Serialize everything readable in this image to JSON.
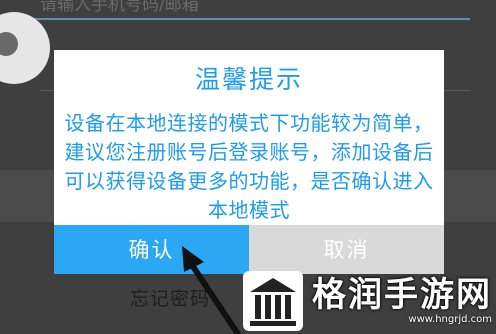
{
  "background": {
    "username_placeholder": "请输入手机号码/邮箱",
    "forgot_password": "忘记密码"
  },
  "dialog": {
    "title": "温馨提示",
    "message": "设备在本地连接的模式下功能较为简单，建议您注册账号后登录账号，添加设备后可以获得设备更多的功能，是否确认进入本地模式",
    "confirm_label": "确认",
    "cancel_label": "取消"
  },
  "watermark": {
    "title": "格润手游网",
    "url": "www.hngrjd.com"
  },
  "colors": {
    "accent": "#1e9bf0",
    "confirm_button": "#2ba7f3",
    "cancel_button": "#d9d9d9"
  },
  "icons": [
    "arrow-annotation-icon",
    "watermark-logo-icon"
  ]
}
